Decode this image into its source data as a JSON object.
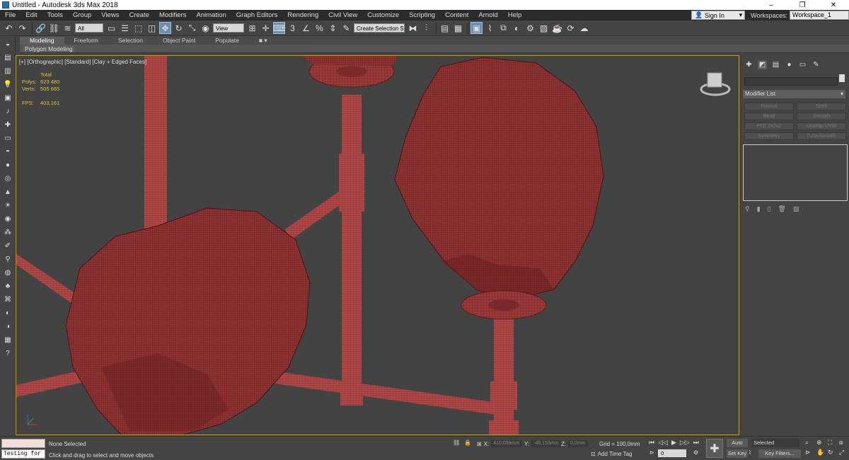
{
  "window": {
    "title": "Untitled - Autodesk 3ds Max 2018",
    "minimize": "–",
    "maximize": "❐",
    "close": "✕"
  },
  "menu": [
    "File",
    "Edit",
    "Tools",
    "Group",
    "Views",
    "Create",
    "Modifiers",
    "Animation",
    "Graph Editors",
    "Rendering",
    "Civil View",
    "Customize",
    "Scripting",
    "Content",
    "Arnold",
    "Help"
  ],
  "signin": "Sign In",
  "workspaces_label": "Workspaces:",
  "workspace": "Workspace_1",
  "toolbar": {
    "filter": "All",
    "ref_coord": "View",
    "selection_set": "Create Selection Se"
  },
  "ribbon": {
    "tabs": [
      "Modeling",
      "Freeform",
      "Selection",
      "Object Paint",
      "Populate"
    ],
    "sub": "Polygon Modeling"
  },
  "viewport": {
    "label": "[+] [Orthographic] [Standard] [Clay + Edged Faces]",
    "stats": {
      "total": "Total",
      "polys_label": "Polys:",
      "polys": "623 480",
      "verts_label": "Verts:",
      "verts": "505 665",
      "fps_label": "FPS:",
      "fps": "403,161"
    }
  },
  "cmdpanel": {
    "modifier_list": "Modifier List",
    "buttons": [
      "Normal",
      "Shell",
      "Bend",
      "Smooth",
      "FFD 2x2x2",
      "Unwrap UVW",
      "Symmetry",
      "TurboSmooth"
    ]
  },
  "status": {
    "selected": "None Selected",
    "prompt": "Click and drag to select and move objects",
    "maxscript": "Testing for :",
    "x_label": "X:",
    "x": "410,058mm",
    "y_label": "Y:",
    "y": "-48,153mm",
    "z_label": "Z:",
    "z": "0,0mm",
    "grid": "Grid = 100,0mm",
    "add_time_tag": "Add Time Tag",
    "frame": "0",
    "auto_key": "Auto Key",
    "set_key": "Set Key",
    "selected_dd": "Selected",
    "key_filters": "Key Filters..."
  }
}
